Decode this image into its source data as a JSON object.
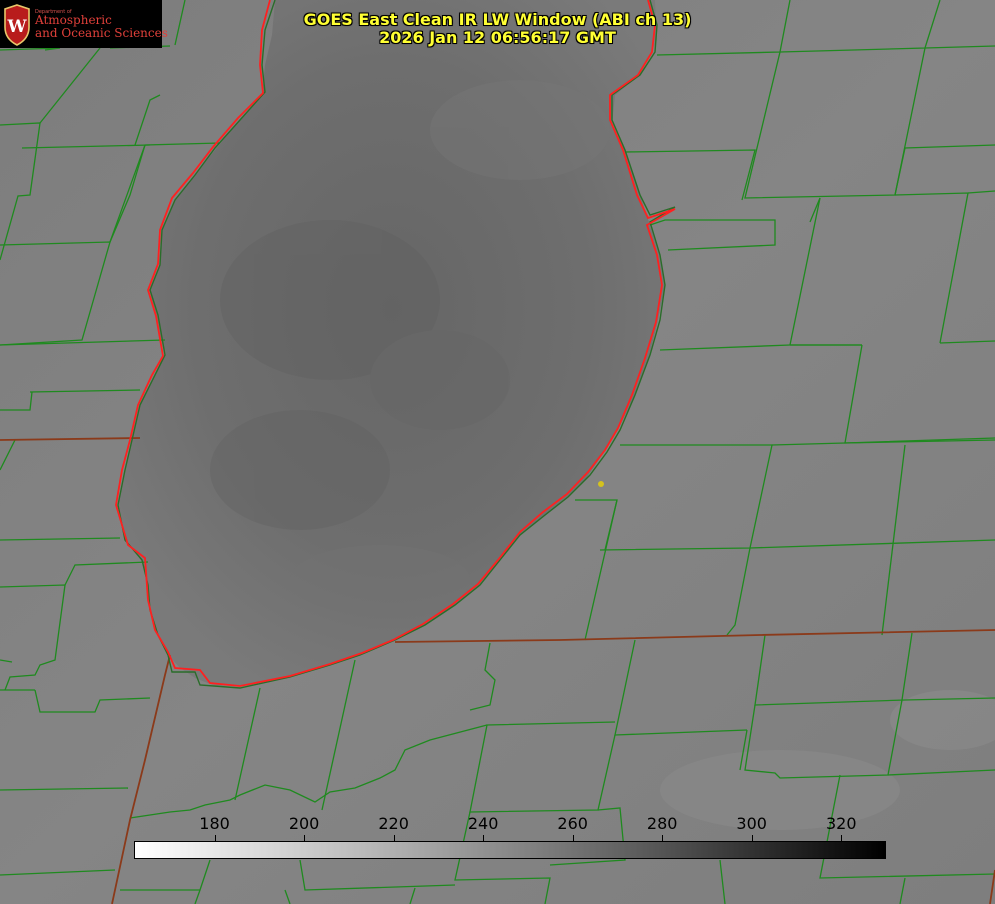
{
  "title": {
    "line1": "GOES East Clean IR LW Window (ABI ch 13)",
    "line2": "2026 Jan 12 06:56:17 GMT"
  },
  "logo": {
    "department": "Department of",
    "name_line1": "Atmospheric",
    "name_line2": "and Oceanic Sciences",
    "crest_letter": "W"
  },
  "colorbar": {
    "ticks": [
      "180",
      "200",
      "220",
      "240",
      "260",
      "280",
      "300",
      "320"
    ],
    "tick_values": [
      180,
      200,
      220,
      240,
      260,
      280,
      300,
      320
    ],
    "range": [
      162,
      330
    ],
    "low_color": "#ffffff",
    "high_color": "#000000"
  },
  "colors": {
    "county_lines": "#1f8a1f",
    "state_lines": "#8b3a1a",
    "lake_outline": "#ff2020",
    "title_text": "#ffff33",
    "station_marker": "#d4c21e"
  },
  "station": {
    "icon": "station-dot-icon"
  }
}
